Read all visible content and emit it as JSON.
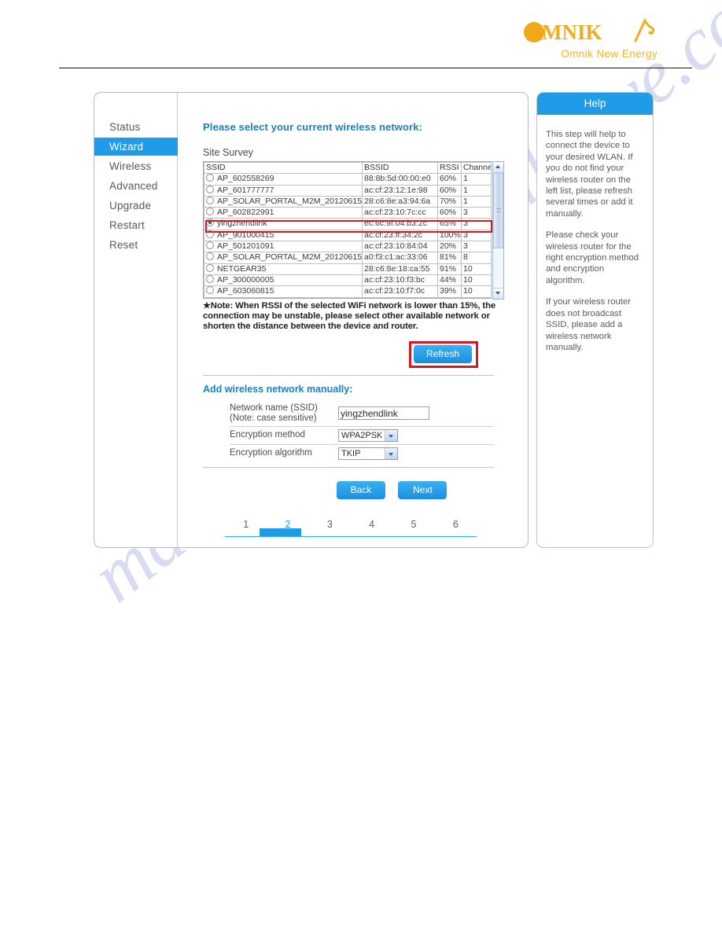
{
  "brand": {
    "logo_word": "MNIK",
    "logo_sub": "Omnik New Energy",
    "accent_blue": "#1e9ce8",
    "accent_orange": "#f0b429",
    "highlight_red": "#d51820"
  },
  "watermark": {
    "line_a": "manualshive.com",
    "line_b": "manualshive.com"
  },
  "sidebar": {
    "items": [
      {
        "label": "Status",
        "active": false
      },
      {
        "label": "Wizard",
        "active": true
      },
      {
        "label": "Wireless",
        "active": false
      },
      {
        "label": "Advanced",
        "active": false
      },
      {
        "label": "Upgrade",
        "active": false
      },
      {
        "label": "Restart",
        "active": false
      },
      {
        "label": "Reset",
        "active": false
      }
    ]
  },
  "content": {
    "title": "Please select your current wireless network:",
    "site_survey_label": "Site Survey",
    "note": "Note: When RSSI of the selected WiFi network is lower than 15%, the connection may be unstable, please select other available network or shorten the distance between the device and router.",
    "note_star": "★",
    "refresh_label": "Refresh",
    "manual_title": "Add wireless network manually:",
    "back_label": "Back",
    "next_label": "Next"
  },
  "survey_table": {
    "headers": [
      "SSID",
      "BSSID",
      "RSSI",
      "Channel"
    ],
    "rows": [
      {
        "ssid": "AP_602558269",
        "bssid": "88:8b:5d:00:00:e0",
        "rssi": "60%",
        "channel": "1",
        "selected": false
      },
      {
        "ssid": "AP_601777777",
        "bssid": "ac:cf:23:12:1e:98",
        "rssi": "60%",
        "channel": "1",
        "selected": false
      },
      {
        "ssid": "AP_SOLAR_PORTAL_M2M_20120615",
        "bssid": "28:c6:8e:a3:94:6a",
        "rssi": "70%",
        "channel": "1",
        "selected": false
      },
      {
        "ssid": "AP_602822991",
        "bssid": "ac:cf:23:10:7c:cc",
        "rssi": "60%",
        "channel": "3",
        "selected": false
      },
      {
        "ssid": "yingzhendlink",
        "bssid": "ec:6c:9f:04:b3:2c",
        "rssi": "65%",
        "channel": "3",
        "selected": true
      },
      {
        "ssid": "AP_901000415",
        "bssid": "ac:cf:23:ff:34:2c",
        "rssi": "100%",
        "channel": "3",
        "selected": false
      },
      {
        "ssid": "AP_501201091",
        "bssid": "ac:cf:23:10:84:04",
        "rssi": "20%",
        "channel": "3",
        "selected": false
      },
      {
        "ssid": "AP_SOLAR_PORTAL_M2M_20120615",
        "bssid": "a0:f3:c1:ac:33:06",
        "rssi": "81%",
        "channel": "8",
        "selected": false
      },
      {
        "ssid": "NETGEAR35",
        "bssid": "28:c6:8e:18:ca:55",
        "rssi": "91%",
        "channel": "10",
        "selected": false
      },
      {
        "ssid": "AP_300000005",
        "bssid": "ac:cf:23:10:f3:bc",
        "rssi": "44%",
        "channel": "10",
        "selected": false
      },
      {
        "ssid": "AP_603060815",
        "bssid": "ac:cf:23:10:f7:0c",
        "rssi": "39%",
        "channel": "10",
        "selected": false
      }
    ]
  },
  "manual_form": {
    "ssid_label_line1": "Network name (SSID)",
    "ssid_label_line2": "(Note: case sensitive)",
    "ssid_value": "yingzhendlink",
    "ssid_placeholder": "",
    "enc_method_label": "Encryption method",
    "enc_method_value": "WPA2PSK",
    "enc_algo_label": "Encryption algorithm",
    "enc_algo_value": "TKIP"
  },
  "steps": {
    "numbers": [
      "1",
      "2",
      "3",
      "4",
      "5",
      "6"
    ],
    "current": "2"
  },
  "help": {
    "title": "Help",
    "paragraphs": [
      "This step will help to connect the device to your desired WLAN. If you do not find your wireless router on the left list, please refresh several times or add it manually.",
      "Please check your wireless router for the right encryption method and encryption algorithm.",
      "If your wireless router does not broadcast SSID, please add a wireless network manually."
    ]
  }
}
